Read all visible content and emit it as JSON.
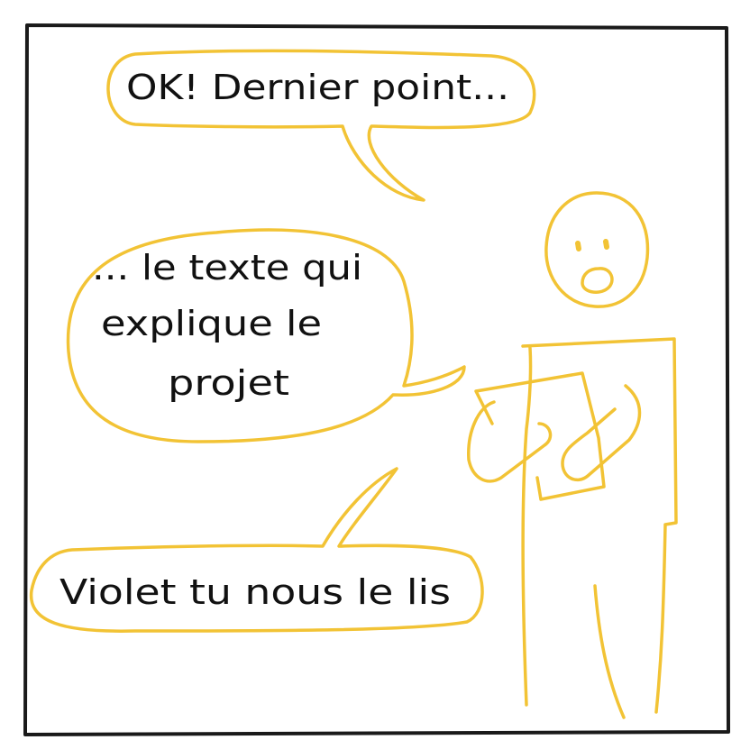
{
  "colors": {
    "frame": "#1a1a1a",
    "accent": "#f2c335",
    "text": "#111111",
    "background": "#ffffff"
  },
  "bubbles": [
    {
      "lines": [
        "OK! Dernier point..."
      ]
    },
    {
      "lines": [
        "... le texte qui",
        "explique le",
        "projet"
      ]
    },
    {
      "lines": [
        "Violet tu nous le lis"
      ]
    }
  ]
}
